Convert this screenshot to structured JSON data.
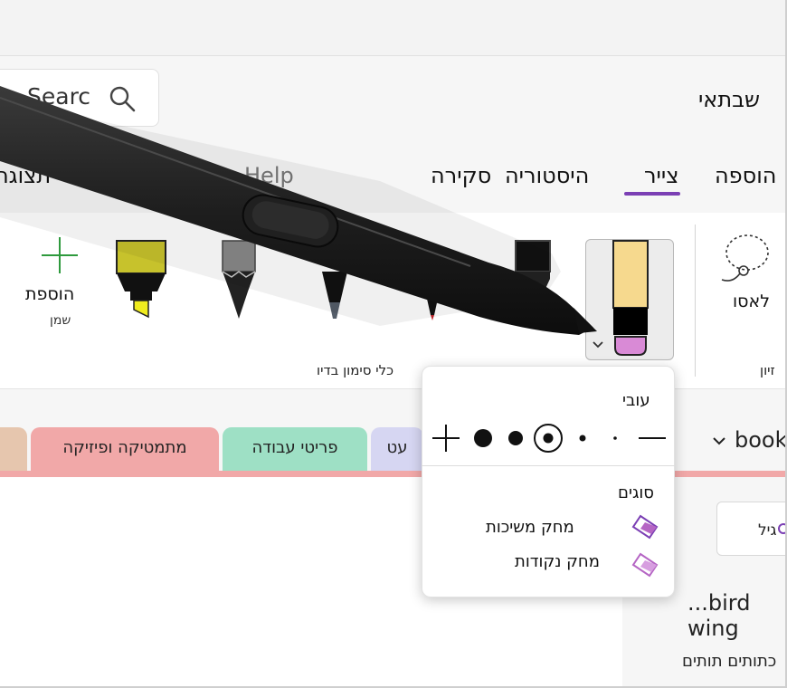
{
  "search": {
    "text": "Searc"
  },
  "account": {
    "name": "שבתאי"
  },
  "tabs": {
    "insert": "הוספה",
    "draw": "צייר",
    "history": "היסטוריה",
    "review": "סקירה",
    "help": "Help",
    "view": "תצוגה"
  },
  "ribbon": {
    "lasso_label": "לאסו",
    "add_label": "הוספת",
    "add_sub": "שמן",
    "group_label": "כלי סימון בדיו",
    "edit_group_label": "זיון"
  },
  "eraser_popup": {
    "thickness_heading": "עובי",
    "types_heading": "סוגים",
    "types": [
      "מחק משיכות",
      "מחק נקודות"
    ]
  },
  "notebook": {
    "label": "book",
    "sections": [
      "מתמטיקה ופיזיקה",
      "פריטי עבודה",
      "עט"
    ]
  },
  "side": {
    "tag_label": "גיל",
    "text1": "...bird wing",
    "text2": "כתותים תותים"
  },
  "colors": {
    "accent": "#7b3fb4",
    "section_pink": "#f1a8a8",
    "section_green": "#9ee0c5",
    "section_lavender": "#d6d6f2",
    "section_tan": "#e6c6ae"
  }
}
